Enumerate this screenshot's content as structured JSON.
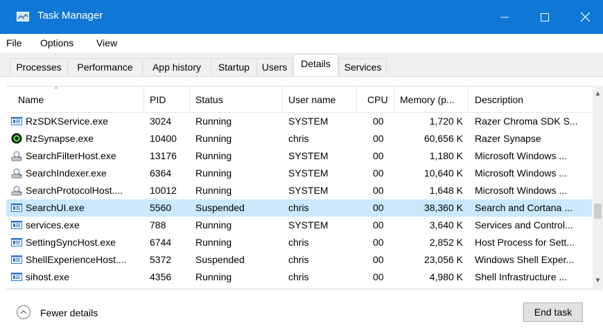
{
  "window": {
    "title": "Task Manager",
    "accent": "#0f78d7"
  },
  "menu": [
    "File",
    "Options",
    "View"
  ],
  "tabs": [
    "Processes",
    "Performance",
    "App history",
    "Startup",
    "Users",
    "Details",
    "Services"
  ],
  "active_tab": "Details",
  "columns": [
    "Name",
    "PID",
    "Status",
    "User name",
    "CPU",
    "Memory (p...",
    "Description"
  ],
  "rows": [
    {
      "name": "RzSDKService.exe",
      "pid": "3024",
      "status": "Running",
      "user": "SYSTEM",
      "cpu": "00",
      "memory": "1,720 K",
      "description": "Razer Chroma SDK S...",
      "icon": "app-window-icon"
    },
    {
      "name": "RzSynapse.exe",
      "pid": "10400",
      "status": "Running",
      "user": "chris",
      "cpu": "00",
      "memory": "60,656 K",
      "description": "Razer Synapse",
      "icon": "razer-synapse-icon"
    },
    {
      "name": "SearchFilterHost.exe",
      "pid": "13176",
      "status": "Running",
      "user": "SYSTEM",
      "cpu": "00",
      "memory": "1,180 K",
      "description": "Microsoft Windows ...",
      "icon": "search-service-icon"
    },
    {
      "name": "SearchIndexer.exe",
      "pid": "6364",
      "status": "Running",
      "user": "SYSTEM",
      "cpu": "00",
      "memory": "10,640 K",
      "description": "Microsoft Windows ...",
      "icon": "search-service-icon"
    },
    {
      "name": "SearchProtocolHost....",
      "pid": "10012",
      "status": "Running",
      "user": "SYSTEM",
      "cpu": "00",
      "memory": "1,648 K",
      "description": "Microsoft Windows ...",
      "icon": "search-service-icon"
    },
    {
      "name": "SearchUI.exe",
      "pid": "5560",
      "status": "Suspended",
      "user": "chris",
      "cpu": "00",
      "memory": "38,360 K",
      "description": "Search and Cortana ...",
      "icon": "app-window-icon",
      "selected": true
    },
    {
      "name": "services.exe",
      "pid": "788",
      "status": "Running",
      "user": "SYSTEM",
      "cpu": "00",
      "memory": "3,640 K",
      "description": "Services and Control...",
      "icon": "app-window-icon"
    },
    {
      "name": "SettingSyncHost.exe",
      "pid": "6744",
      "status": "Running",
      "user": "chris",
      "cpu": "00",
      "memory": "2,852 K",
      "description": "Host Process for Sett...",
      "icon": "app-window-icon"
    },
    {
      "name": "ShellExperienceHost....",
      "pid": "5372",
      "status": "Suspended",
      "user": "chris",
      "cpu": "00",
      "memory": "23,056 K",
      "description": "Windows Shell Exper...",
      "icon": "app-window-icon"
    },
    {
      "name": "sihost.exe",
      "pid": "4356",
      "status": "Running",
      "user": "chris",
      "cpu": "00",
      "memory": "4,980 K",
      "description": "Shell Infrastructure ...",
      "icon": "app-window-icon"
    }
  ],
  "footer": {
    "fewer_details": "Fewer details",
    "end_task": "End task"
  }
}
